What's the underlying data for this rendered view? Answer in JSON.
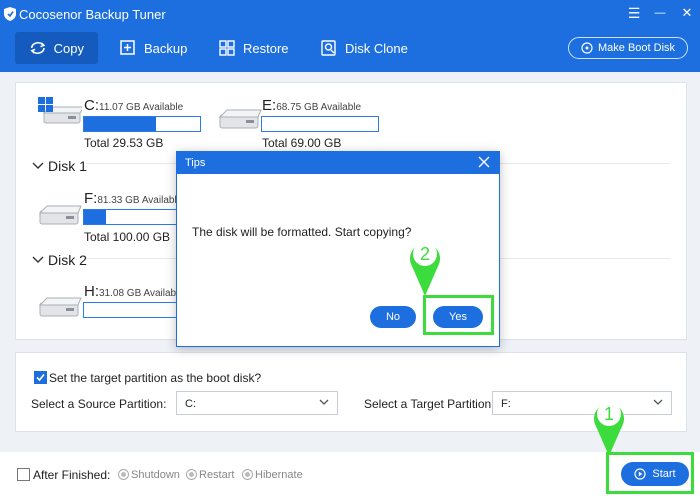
{
  "app": {
    "title": "Cocosenor Backup Tuner"
  },
  "window_controls": {
    "menu": "☰",
    "minimize": "—",
    "close": "✕"
  },
  "toolbar": {
    "copy_label": "Copy",
    "backup_label": "Backup",
    "restore_label": "Restore",
    "diskclone_label": "Disk Clone",
    "boot_disk_label": "Make Boot Disk",
    "active_tab": "Copy"
  },
  "disk0": {
    "partitions": [
      {
        "letter": "C:",
        "available": "11.07 GB Available",
        "total": "Total 29.53 GB",
        "used_fraction": 0.62
      },
      {
        "letter": "E:",
        "available": "68.75 GB Available",
        "total": "Total 69.00 GB",
        "used_fraction": 0.0
      }
    ]
  },
  "disk1": {
    "name": "Disk 1",
    "partitions": [
      {
        "letter": "F:",
        "available": "81.33 GB Available",
        "total": "Total 100.00 GB",
        "used_fraction": 0.19
      }
    ]
  },
  "disk2": {
    "name": "Disk 2",
    "partitions": [
      {
        "letter": "H:",
        "available": "31.08 GB Available",
        "used_fraction": 0.0
      }
    ]
  },
  "options": {
    "boot_checkbox_label": "Set the target partition as the boot disk?",
    "boot_checked": true,
    "source_label": "Select a Source Partition:",
    "source_value": "C:",
    "target_label": "Select a Target Partition:",
    "target_value": "F:"
  },
  "footer": {
    "after_finished_label": "After Finished:",
    "after_finished_checked": false,
    "shutdown_label": "Shutdown",
    "restart_label": "Restart",
    "hibernate_label": "Hibernate",
    "start_label": "Start"
  },
  "dialog": {
    "title": "Tips",
    "message": "The disk will be formatted. Start copying?",
    "no_label": "No",
    "yes_label": "Yes"
  },
  "annotations": {
    "marker1": "1",
    "marker2": "2",
    "color": "#3ddc3d"
  },
  "colors": {
    "primary": "#1d6fdf",
    "active_tab": "#155bbd",
    "background": "#eef1f6",
    "highlight": "#3ddc3d"
  },
  "icons": {
    "logo": "shield-logo-icon",
    "copy": "copy-sync-icon",
    "backup": "backup-plus-icon",
    "restore": "restore-grid-icon",
    "disk_clone": "disk-clone-icon",
    "boot_disk": "boot-disk-icon",
    "windows": "windows-logo-icon",
    "drive": "hard-drive-icon",
    "chevron": "chevron-down-icon",
    "start": "play-circle-icon",
    "close": "close-icon"
  }
}
